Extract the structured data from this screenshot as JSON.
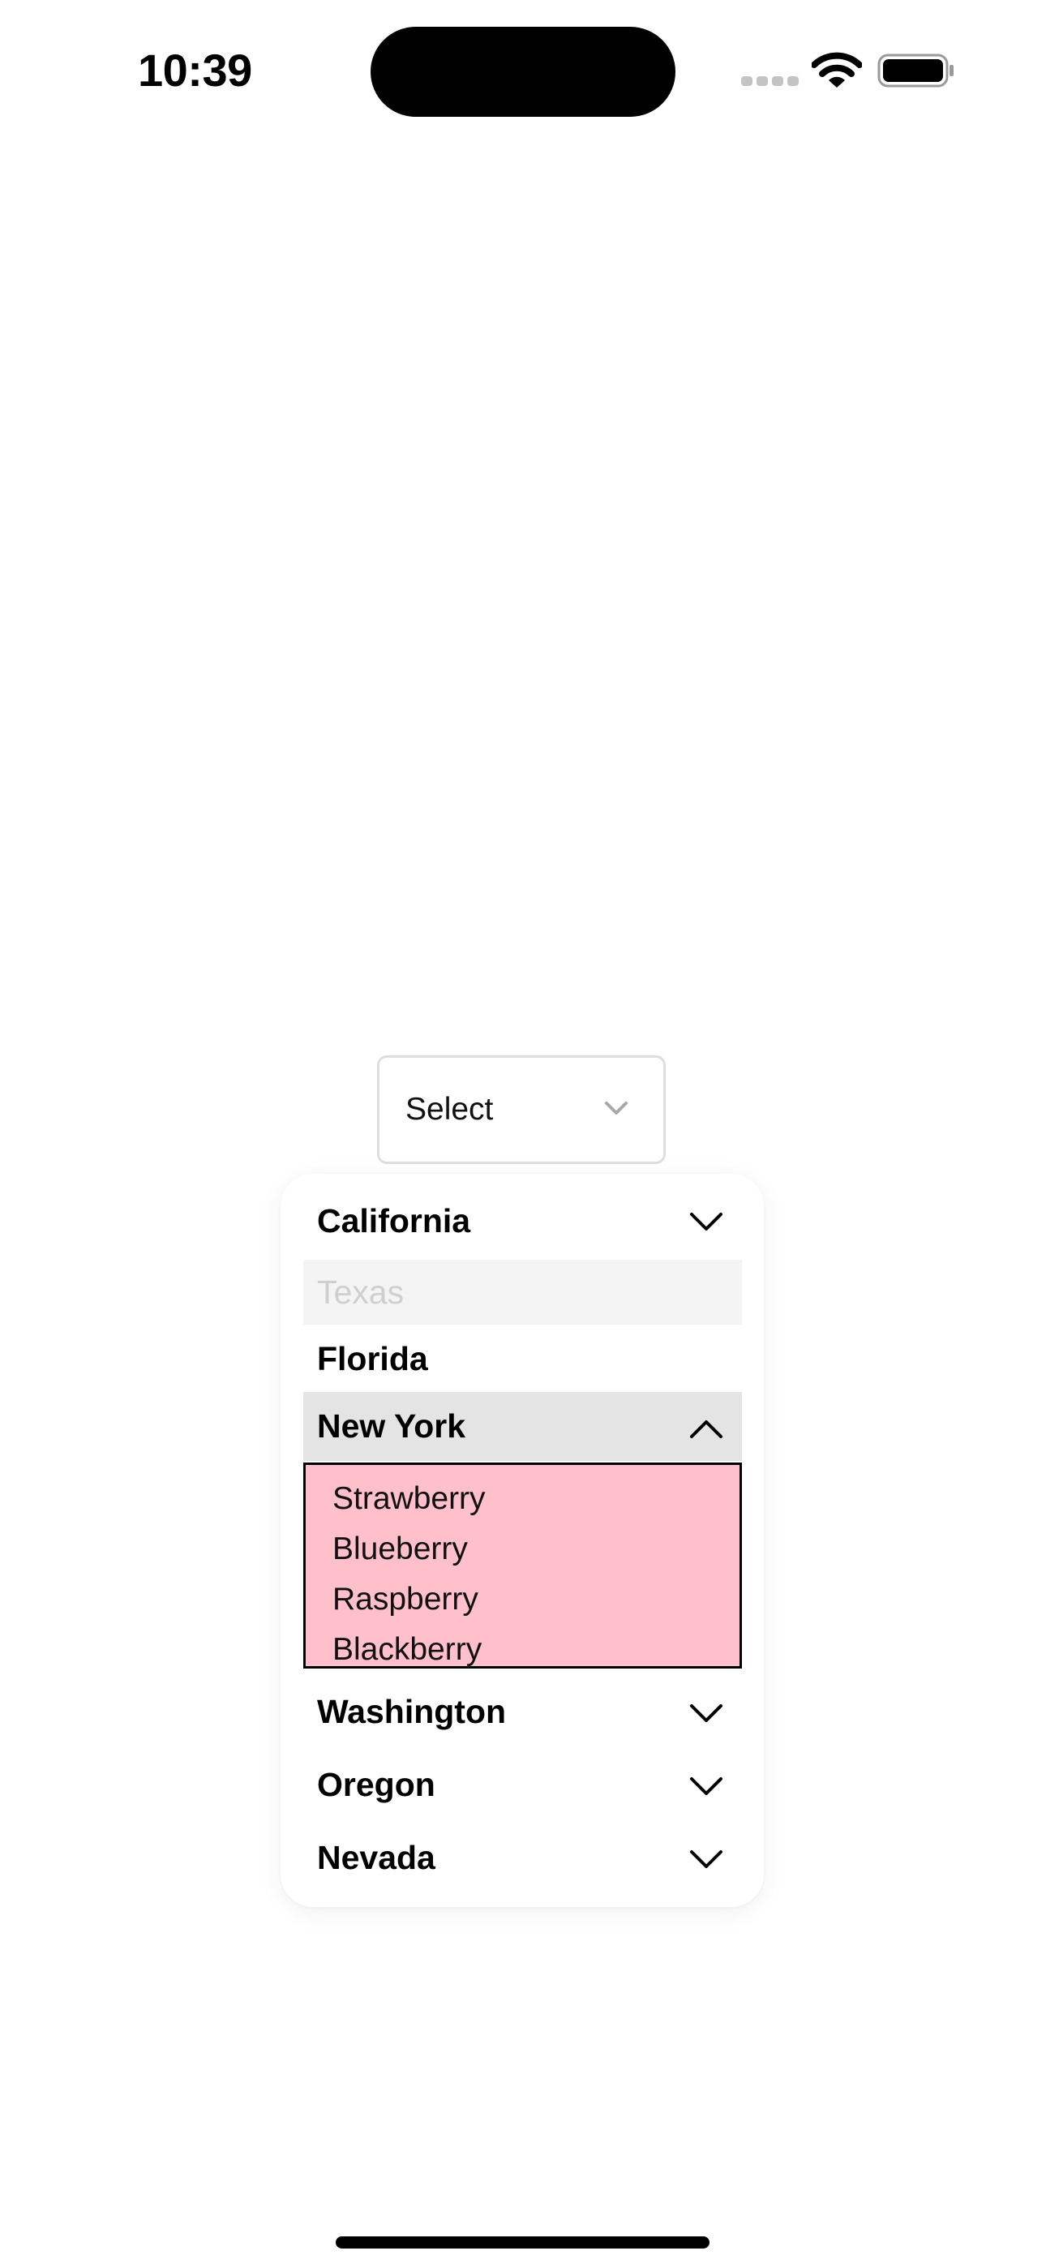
{
  "status_bar": {
    "time": "10:39"
  },
  "select": {
    "label": "Select",
    "chevron_icon": "chevron-down-icon"
  },
  "dropdown": {
    "items": [
      {
        "label": "California",
        "state": "collapsed",
        "icon": "chevron-down-icon"
      },
      {
        "label": "Texas",
        "state": "disabled"
      },
      {
        "label": "Florida",
        "state": "plain"
      },
      {
        "label": "New York",
        "state": "expanded",
        "icon": "chevron-up-icon",
        "children": [
          "Strawberry",
          "Blueberry",
          "Raspberry",
          "Blackberry"
        ]
      },
      {
        "label": "Washington",
        "state": "collapsed",
        "icon": "chevron-down-icon"
      },
      {
        "label": "Oregon",
        "state": "collapsed",
        "icon": "chevron-down-icon"
      },
      {
        "label": "Nevada",
        "state": "collapsed",
        "icon": "chevron-down-icon"
      }
    ]
  },
  "colors": {
    "submenu_background": "#ffc0cb",
    "expanded_row_background": "#e4e4e4",
    "disabled_row_background": "#f4f4f4",
    "disabled_text": "#cfcfcf"
  }
}
